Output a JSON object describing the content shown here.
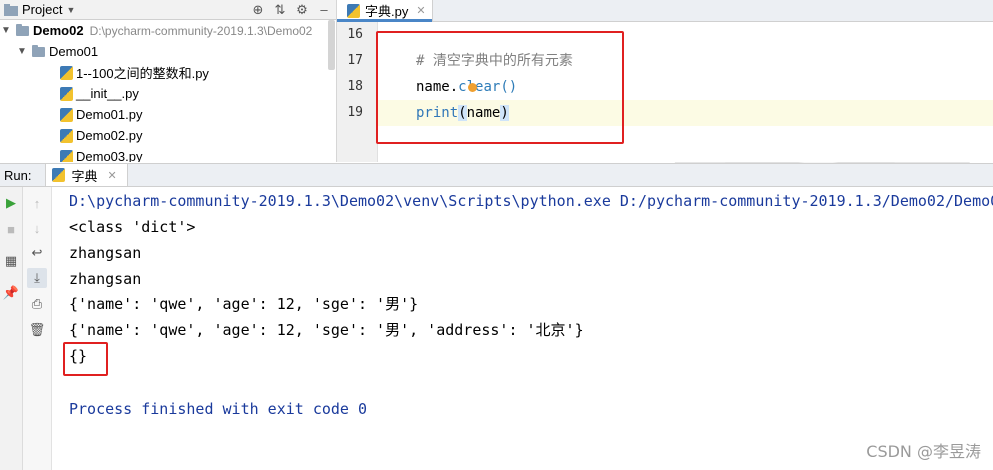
{
  "project": {
    "title": "Project",
    "root_name": "Demo02",
    "root_path": "D:\\pycharm-community-2019.1.3\\Demo02",
    "folder_name": "Demo01",
    "files": [
      "1--100之间的整数和.py",
      "__init__.py",
      "Demo01.py",
      "Demo02.py",
      "Demo03.py"
    ]
  },
  "editor": {
    "tab_name": "字典.py",
    "lines": [
      {
        "num": "16"
      },
      {
        "num": "17",
        "comment": "# 清空字典中的所有元素"
      },
      {
        "num": "18",
        "obj": "name",
        "dot": ".",
        "method": "clear",
        "parens": "()"
      },
      {
        "num": "19",
        "builtin": "print",
        "open": "(",
        "arg": "name",
        "close": ")"
      }
    ]
  },
  "run": {
    "label": "Run:",
    "tab_name": "字典",
    "output": [
      "D:\\pycharm-community-2019.1.3\\Demo02\\venv\\Scripts\\python.exe D:/pycharm-community-2019.1.3/Demo02/Demo01",
      "<class 'dict'>",
      "zhangsan",
      "zhangsan",
      "{'name': 'qwe', 'age': 12, 'sge': '男'}",
      "{'name': 'qwe', 'age': 12, 'sge': '男', 'address': '北京'}",
      "{}",
      "",
      "Process finished with exit code 0"
    ]
  },
  "watermark": "CSDN @李昱涛",
  "colors": {
    "highlight_box": "#e02020",
    "console_path": "#1a3a9c",
    "method": "#2e7cb8"
  }
}
